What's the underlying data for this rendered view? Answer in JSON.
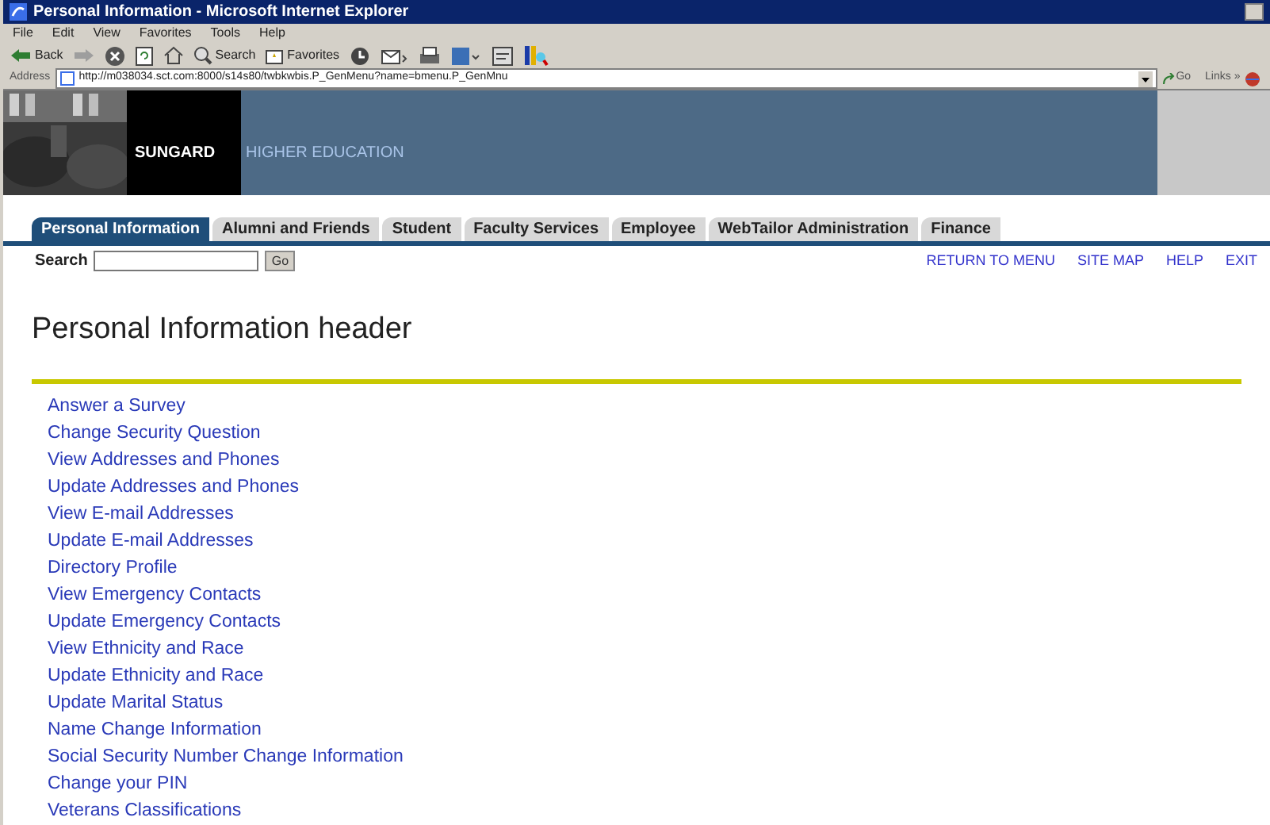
{
  "window": {
    "title": "Personal Information - Microsoft Internet Explorer"
  },
  "menu": [
    "File",
    "Edit",
    "View",
    "Favorites",
    "Tools",
    "Help"
  ],
  "toolbar": [
    {
      "kind": "back",
      "label": "Back"
    },
    {
      "kind": "forward"
    },
    {
      "kind": "stop"
    },
    {
      "kind": "refresh"
    },
    {
      "kind": "home"
    },
    {
      "kind": "search",
      "label": "Search"
    },
    {
      "kind": "favorites",
      "label": "Favorites"
    },
    {
      "kind": "history"
    },
    {
      "kind": "mail"
    },
    {
      "kind": "print"
    },
    {
      "kind": "edit"
    },
    {
      "kind": "discuss"
    },
    {
      "kind": "messenger"
    }
  ],
  "address": {
    "label": "Address",
    "value": "http://m038034.sct.com:8000/s14s80/twbkwbis.P_GenMenu?name=bmenu.P_GenMnu",
    "go": "Go",
    "links": "Links »"
  },
  "banner": {
    "brand": "SUNGARD",
    "subtitle": "HIGHER EDUCATION"
  },
  "tabs": [
    {
      "label": "Personal Information",
      "selected": true
    },
    {
      "label": "Alumni and Friends",
      "selected": false
    },
    {
      "label": "Student",
      "selected": false
    },
    {
      "label": "Faculty Services",
      "selected": false
    },
    {
      "label": "Employee",
      "selected": false
    },
    {
      "label": "WebTailor Administration",
      "selected": false
    },
    {
      "label": "Finance",
      "selected": false
    }
  ],
  "search": {
    "label": "Search",
    "button": "Go"
  },
  "nav_links": [
    "RETURN TO MENU",
    "SITE MAP",
    "HELP",
    "EXIT"
  ],
  "header": "Personal Information header",
  "links": [
    "Answer a Survey",
    "Change Security Question",
    "View Addresses and Phones",
    "Update Addresses and Phones",
    "View E-mail Addresses",
    "Update E-mail Addresses",
    "Directory Profile",
    "View Emergency Contacts",
    "Update Emergency Contacts",
    "View Ethnicity and Race",
    "Update Ethnicity and Race",
    "Update Marital Status",
    "Name Change Information",
    "Social Security Number Change Information",
    "Change your PIN",
    "Veterans Classifications"
  ]
}
